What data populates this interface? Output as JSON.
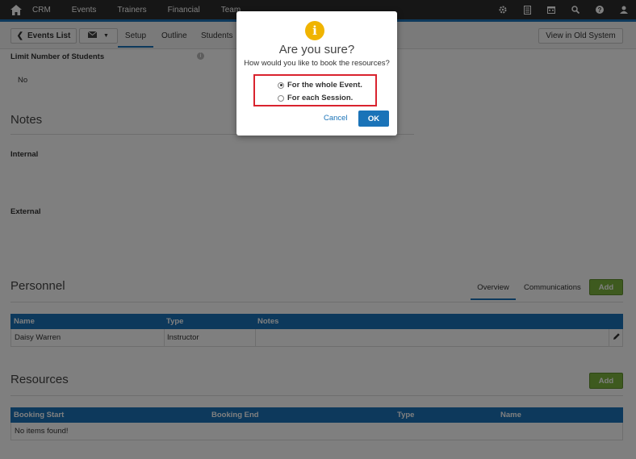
{
  "topnav": {
    "items": [
      "CRM",
      "Events",
      "Trainers",
      "Financial",
      "Team"
    ],
    "icons": [
      "gear-icon",
      "document-icon",
      "calendar-icon",
      "search-icon",
      "help-icon",
      "user-icon"
    ]
  },
  "toolbar": {
    "events_list_label": "Events List",
    "tabs": [
      "Setup",
      "Outline",
      "Students"
    ],
    "old_system_label": "View in Old System"
  },
  "fields": {
    "limit_label": "Limit Number of Students",
    "limit_value": "No"
  },
  "notes": {
    "title": "Notes",
    "internal_label": "Internal",
    "external_label": "External"
  },
  "personnel": {
    "title": "Personnel",
    "tabs": [
      "Overview",
      "Communications"
    ],
    "add_label": "Add",
    "columns": [
      "Name",
      "Type",
      "Notes"
    ],
    "rows": [
      [
        "Daisy Warren",
        "Instructor",
        ""
      ]
    ]
  },
  "resources": {
    "title": "Resources",
    "add_label": "Add",
    "columns": [
      "Booking Start",
      "Booking End",
      "Type",
      "Name"
    ],
    "empty_text": "No items found!"
  },
  "modal": {
    "title": "Are you sure?",
    "subtitle": "How would you like to book the resources?",
    "options": [
      "For the whole Event.",
      "For each Session."
    ],
    "selected_index": 0,
    "cancel_label": "Cancel",
    "ok_label": "OK"
  },
  "colors": {
    "accent": "#1a73b8",
    "add_green": "#7cb43e",
    "highlight_red": "#d9232e",
    "info_yellow": "#f0b400"
  }
}
